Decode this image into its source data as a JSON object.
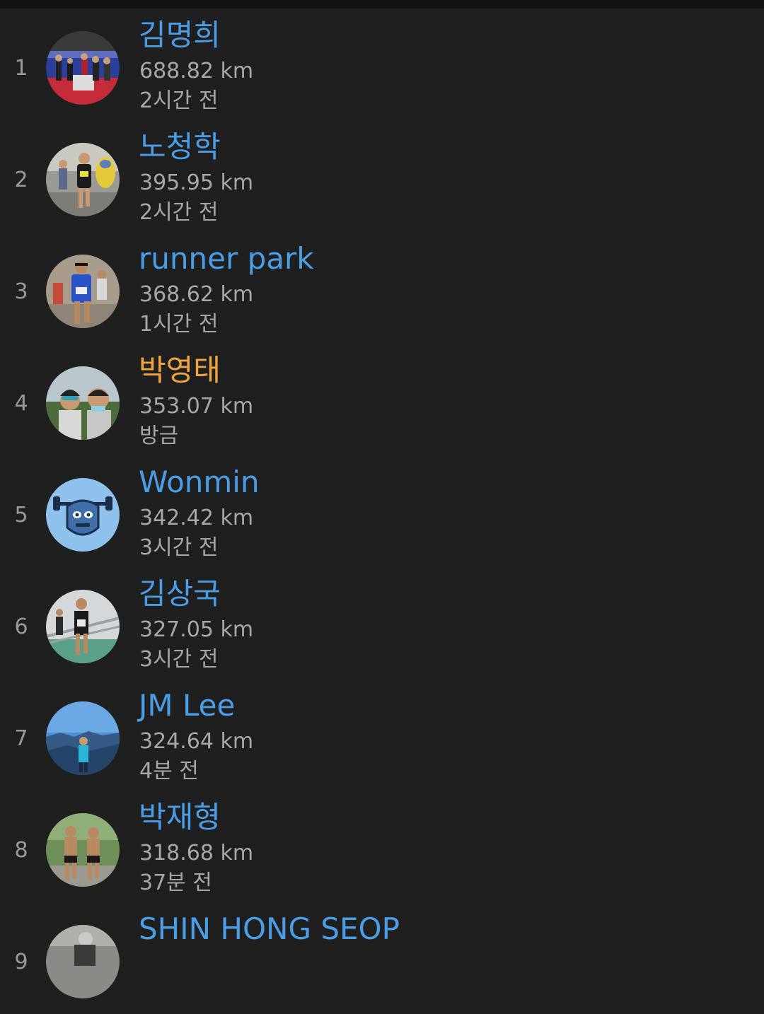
{
  "colors": {
    "background": "#1f1f1f",
    "name_default": "#4a9ee8",
    "name_self": "#f0a640",
    "secondary_text": "#a8a8a8"
  },
  "leaderboard": [
    {
      "rank": "1",
      "name": "김명희",
      "distance": "688.82 km",
      "time": "2시간 전",
      "highlight": false,
      "avatar": "race-podium-photo"
    },
    {
      "rank": "2",
      "name": "노청학",
      "distance": "395.95 km",
      "time": "2시간 전",
      "highlight": false,
      "avatar": "running-race-photo"
    },
    {
      "rank": "3",
      "name": "runner park",
      "distance": "368.62 km",
      "time": "1시간 전",
      "highlight": false,
      "avatar": "marathon-runner-photo"
    },
    {
      "rank": "4",
      "name": "박영태",
      "distance": "353.07 km",
      "time": "방금",
      "highlight": true,
      "avatar": "two-friends-selfie-photo"
    },
    {
      "rank": "5",
      "name": "Wonmin",
      "distance": "342.42 km",
      "time": "3시간 전",
      "highlight": false,
      "avatar": "default-mascot-avatar"
    },
    {
      "rank": "6",
      "name": "김상국",
      "distance": "327.05 km",
      "time": "3시간 전",
      "highlight": false,
      "avatar": "bridge-runner-photo"
    },
    {
      "rank": "7",
      "name": "JM Lee",
      "distance": "324.64 km",
      "time": "4분 전",
      "highlight": false,
      "avatar": "mountain-summit-photo"
    },
    {
      "rank": "8",
      "name": "박재형",
      "distance": "318.68 km",
      "time": "37분 전",
      "highlight": false,
      "avatar": "two-runners-photo"
    },
    {
      "rank": "9",
      "name": "SHIN HONG SEOP",
      "distance": "",
      "time": "",
      "highlight": false,
      "avatar": "cyclist-photo"
    }
  ]
}
